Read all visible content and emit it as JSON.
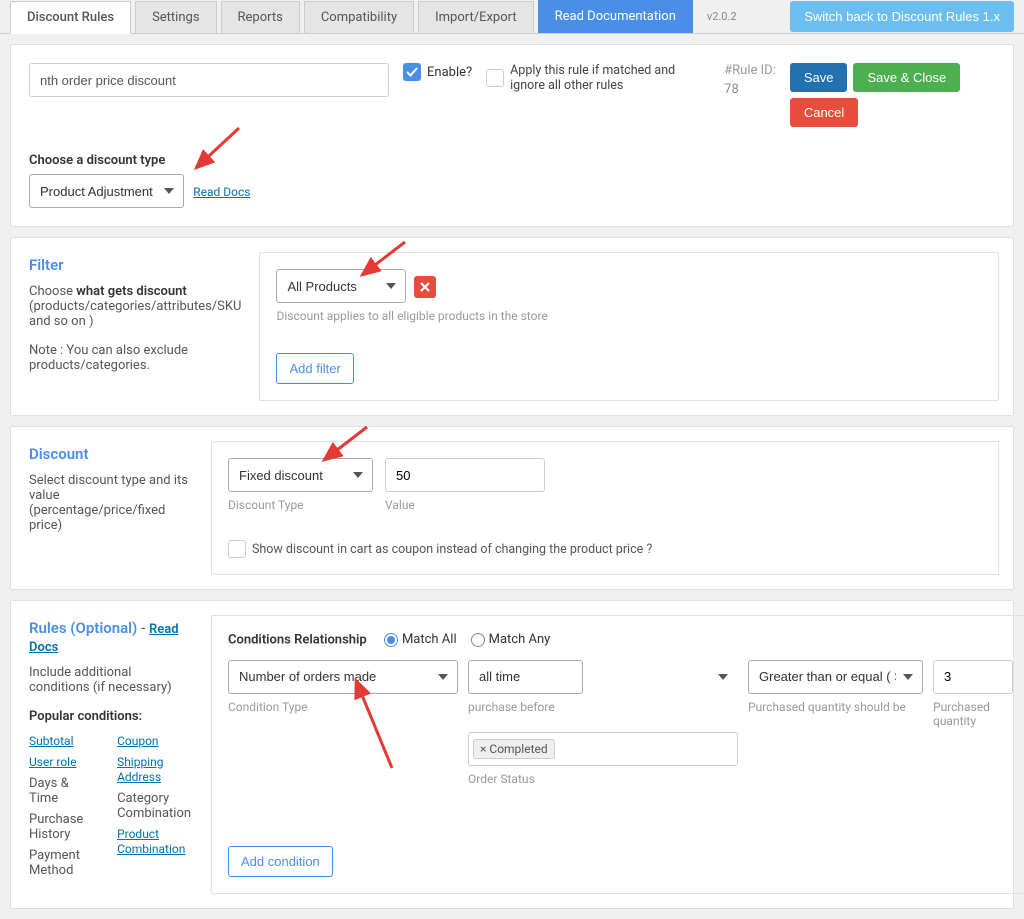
{
  "tabs": {
    "discount_rules": "Discount Rules",
    "settings": "Settings",
    "reports": "Reports",
    "compatibility": "Compatibility",
    "import_export": "Import/Export",
    "read_docs": "Read Documentation"
  },
  "version": "v2.0.2",
  "switch_back": "Switch back to Discount Rules 1.x",
  "header": {
    "rule_name": "nth order price discount",
    "enable_label": "Enable?",
    "ignore_label": "Apply this rule if matched and ignore all other rules",
    "rule_id_label": "#Rule ID:",
    "rule_id": "78",
    "save": "Save",
    "save_close": "Save & Close",
    "cancel": "Cancel"
  },
  "dtype": {
    "label": "Choose a discount type",
    "value": "Product Adjustment",
    "read_docs": "Read Docs"
  },
  "filter": {
    "title": "Filter",
    "desc1": "Choose ",
    "desc1b": "what gets discount",
    "desc2": " (products/categories/attributes/SKU and so on )",
    "note": "Note : You can also exclude products/categories.",
    "value": "All Products",
    "hint": "Discount applies to all eligible products in the store",
    "add": "Add filter"
  },
  "discount": {
    "title": "Discount",
    "desc": "Select discount type and its value (percentage/price/fixed price)",
    "type": "Fixed discount",
    "value": "50",
    "type_label": "Discount Type",
    "value_label": "Value",
    "coupon_label": "Show discount in cart as coupon instead of changing the product price ?"
  },
  "rules": {
    "title": "Rules (Optional)",
    "read_docs": "Read Docs",
    "desc": "Include additional conditions (if necessary)",
    "popular": "Popular conditions:",
    "links_left": [
      "Subtotal",
      "User role",
      "Days & Time",
      "Purchase History",
      "Payment Method"
    ],
    "links_right": [
      "Coupon",
      "Shipping Address",
      "Category Combination",
      "Product Combination"
    ],
    "cond_rel_label": "Conditions Relationship",
    "match_all": "Match All",
    "match_any": "Match Any",
    "cond_type": "Number of orders made",
    "cond_type_label": "Condition Type",
    "purchase_before": "all time",
    "purchase_before_label": "purchase before",
    "qty_should": "Greater than or equal ( >= )",
    "qty_should_label": "Purchased quantity should be",
    "qty": "3",
    "qty_label": "Purchased quantity",
    "status_tag": "× Completed",
    "status_label": "Order Status",
    "add": "Add condition"
  }
}
